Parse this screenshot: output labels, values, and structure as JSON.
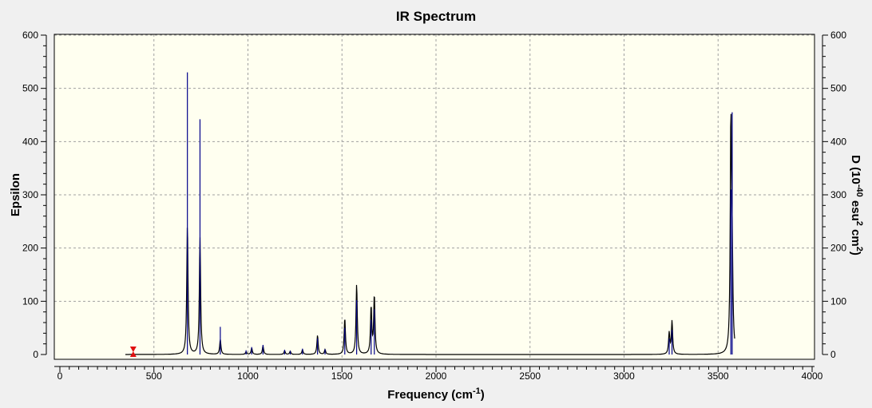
{
  "chart_data": {
    "type": "line",
    "title": "IR Spectrum",
    "xlabel": {
      "base": "Frequency (cm",
      "sup": "-1",
      "tail": ")"
    },
    "ylabel": "Epsilon",
    "y2label": {
      "p1": "D (10",
      "s1": "-40",
      "p2": " esu",
      "s2": "2",
      "p3": " cm",
      "s3": "2",
      "p4": ")"
    },
    "xlim": [
      0,
      4000
    ],
    "ylim": [
      0,
      600
    ],
    "y2lim": [
      0,
      600
    ],
    "xticks": [
      0,
      500,
      1000,
      1500,
      2000,
      2500,
      3000,
      3500,
      4000
    ],
    "yticks": [
      0,
      100,
      200,
      300,
      400,
      500,
      600
    ],
    "y2ticks": [
      0,
      100,
      200,
      300,
      400,
      500,
      600
    ],
    "grid": true,
    "marker_x": 390,
    "colors": {
      "spectrum": "#000000",
      "sticks": "#00008b",
      "marker": "#e01010",
      "plot_bg": "#fffff0",
      "window_bg": "#f0f0f0",
      "grid": "#a0a0a0"
    },
    "peaks": [
      {
        "x": 678,
        "y": 245,
        "d": 530
      },
      {
        "x": 745,
        "y": 220,
        "d": 442
      },
      {
        "x": 853,
        "y": 28,
        "d": 52
      },
      {
        "x": 990,
        "y": 5,
        "d": 8
      },
      {
        "x": 1020,
        "y": 12,
        "d": 14
      },
      {
        "x": 1080,
        "y": 16,
        "d": 18
      },
      {
        "x": 1195,
        "y": 7,
        "d": 9
      },
      {
        "x": 1225,
        "y": 6,
        "d": 7
      },
      {
        "x": 1290,
        "y": 9,
        "d": 11
      },
      {
        "x": 1370,
        "y": 36,
        "d": 30
      },
      {
        "x": 1410,
        "y": 9,
        "d": 10
      },
      {
        "x": 1515,
        "y": 68,
        "d": 50
      },
      {
        "x": 1578,
        "y": 132,
        "d": 102
      },
      {
        "x": 1655,
        "y": 88,
        "d": 65
      },
      {
        "x": 1672,
        "y": 110,
        "d": 85
      },
      {
        "x": 3240,
        "y": 40,
        "d": 30
      },
      {
        "x": 3255,
        "y": 62,
        "d": 46
      },
      {
        "x": 3568,
        "y": 428,
        "d": 310
      },
      {
        "x": 3575,
        "y": 160,
        "d": 455
      }
    ]
  }
}
